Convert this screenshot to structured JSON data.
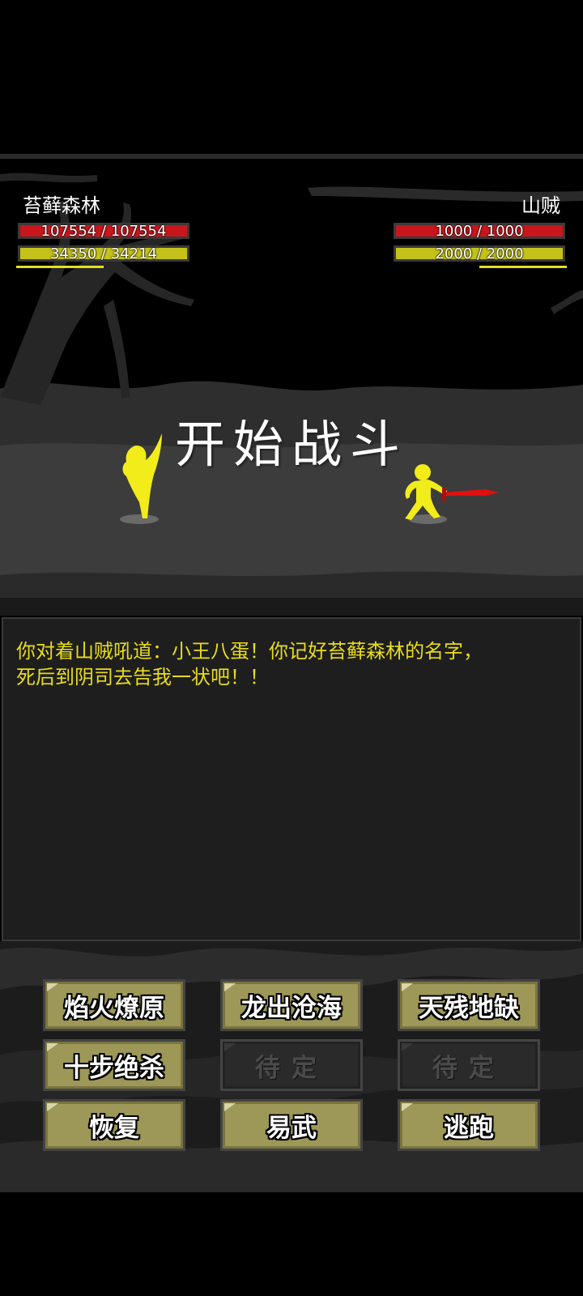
{
  "player": {
    "name": "苔藓森林",
    "hp_text": "107554 / 107554",
    "mp_text": "34350 / 34214"
  },
  "enemy": {
    "name": "山贼",
    "hp_text": "1000 / 1000",
    "mp_text": "2000 / 2000"
  },
  "battle_title": "开始战斗",
  "log": {
    "lines": [
      "你对着山贼吼道：小王八蛋！你记好苔藓森林的名字，",
      "死后到阴司去告我一状吧！！"
    ]
  },
  "skills": [
    {
      "label": "焰火燎原",
      "enabled": true
    },
    {
      "label": "龙出沧海",
      "enabled": true
    },
    {
      "label": "天残地缺",
      "enabled": true
    },
    {
      "label": "十步绝杀",
      "enabled": true
    },
    {
      "label": "待定",
      "enabled": false
    },
    {
      "label": "待定",
      "enabled": false
    },
    {
      "label": "恢复",
      "enabled": true
    },
    {
      "label": "易武",
      "enabled": true
    },
    {
      "label": "逃跑",
      "enabled": true
    }
  ],
  "colors": {
    "hp_bar": "#c8161c",
    "mp_bar": "#c4c21a",
    "character": "#f2ec1a",
    "weapon": "#e01010",
    "log_text": "#e8dc1c",
    "skill_button": "#9e9858"
  }
}
